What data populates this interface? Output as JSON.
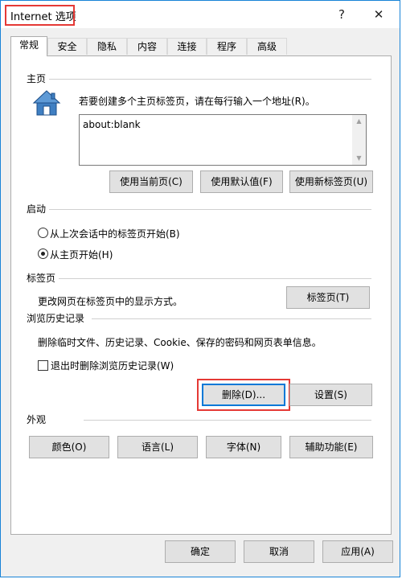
{
  "window": {
    "title": "Internet 选项",
    "help": "?",
    "close": "✕"
  },
  "tabs": [
    "常规",
    "安全",
    "隐私",
    "内容",
    "连接",
    "程序",
    "高级"
  ],
  "home": {
    "section": "主页",
    "instruction": "若要创建多个主页标签页，请在每行输入一个地址(R)。",
    "value": "about:blank",
    "btn_current": "使用当前页(C)",
    "btn_default": "使用默认值(F)",
    "btn_newtab": "使用新标签页(U)"
  },
  "startup": {
    "section": "启动",
    "opt_last": "从上次会话中的标签页开始(B)",
    "opt_home": "从主页开始(H)",
    "selected": "opt_home"
  },
  "tabsec": {
    "section": "标签页",
    "desc": "更改网页在标签页中的显示方式。",
    "btn": "标签页(T)"
  },
  "history": {
    "section": "浏览历史记录",
    "desc": "删除临时文件、历史记录、Cookie、保存的密码和网页表单信息。",
    "checkbox": "退出时删除浏览历史记录(W)",
    "checked": false,
    "btn_delete": "删除(D)...",
    "btn_settings": "设置(S)"
  },
  "appearance": {
    "section": "外观",
    "btn_colors": "颜色(O)",
    "btn_languages": "语言(L)",
    "btn_fonts": "字体(N)",
    "btn_accessibility": "辅助功能(E)"
  },
  "footer": {
    "ok": "确定",
    "cancel": "取消",
    "apply": "应用(A)"
  },
  "colors": {
    "accent": "#0078d7",
    "highlight": "#e53935",
    "house": "#3f7fc2"
  }
}
